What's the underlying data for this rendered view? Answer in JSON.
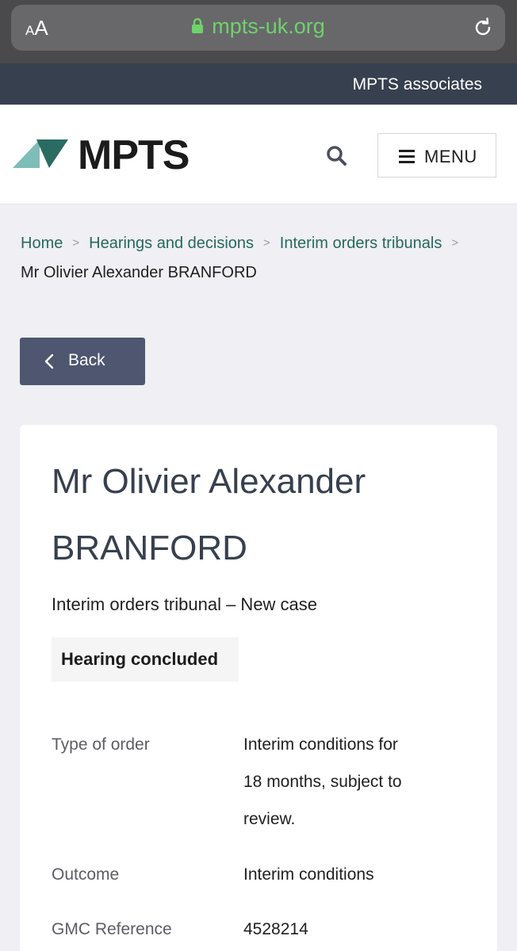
{
  "browser": {
    "text_size_label_small": "A",
    "text_size_label_large": "A",
    "url": "mpts-uk.org",
    "icons": [
      "lock-icon",
      "reload-icon"
    ]
  },
  "topbar": {
    "associates_link": "MPTS associates"
  },
  "header": {
    "logo_text": "MPTS",
    "menu_label": "MENU",
    "icons": [
      "search-icon",
      "hamburger-icon"
    ]
  },
  "breadcrumb": {
    "items": [
      "Home",
      "Hearings and decisions",
      "Interim orders tribunals"
    ],
    "separator": ">",
    "current": "Mr Olivier Alexander BRANFORD"
  },
  "back_button": {
    "label": "Back"
  },
  "case": {
    "title_line1": "Mr Olivier Alexander",
    "title_line2": "BRANFORD",
    "subtitle": "Interim orders tribunal – New case",
    "status": "Hearing concluded",
    "details": [
      {
        "label": "Type of order",
        "value_lines": [
          "Interim conditions for",
          "18 months, subject to",
          "review."
        ]
      },
      {
        "label": "Outcome",
        "value_lines": [
          "Interim conditions"
        ]
      },
      {
        "label": "GMC Reference",
        "value_lines": [
          "4528214"
        ]
      }
    ]
  },
  "colors": {
    "browser_chrome": "#4a4a4c",
    "url_green": "#6fd26a",
    "nav_dark": "#37404f",
    "link_teal": "#26695d",
    "button_slate": "#4e5670",
    "logo_light": "#7fbdb8",
    "logo_dark": "#2a6b62"
  }
}
